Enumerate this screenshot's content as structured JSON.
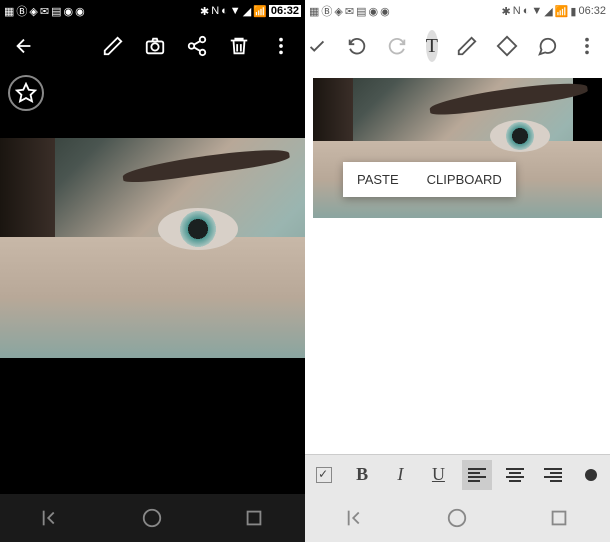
{
  "status": {
    "clock": "06:32"
  },
  "left_toolbar": {
    "back": "←",
    "edit": "✎",
    "camera": "📷",
    "share": "⋔",
    "delete": "🗑",
    "more": "⋮"
  },
  "right_toolbar": {
    "check": "✓",
    "undo": "↶",
    "redo": "↷",
    "text": "T",
    "pen": "✎",
    "eraser": "◇",
    "comment": "💬",
    "more": "⋮"
  },
  "context_menu": {
    "paste": "PASTE",
    "clipboard": "CLIPBOARD"
  },
  "format": {
    "bold": "B",
    "italic": "I",
    "underline": "U"
  },
  "nav": {
    "back": "◁",
    "home": "○",
    "recent": "□"
  }
}
